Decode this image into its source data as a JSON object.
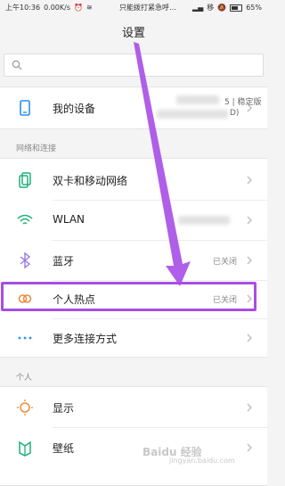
{
  "status": {
    "time": "上午10:36",
    "speed": "0.00K/s",
    "center_text": "只能拨打紧急呼…",
    "carrier": "移",
    "battery": "65%"
  },
  "page": {
    "title": "设置"
  },
  "search": {
    "placeholder": ""
  },
  "device": {
    "label": "我的设备",
    "version_top": "5 | 稳定版",
    "version_bottom": "D)"
  },
  "network_section": {
    "header": "网络和连接",
    "items": [
      {
        "label": "双卡和移动网络",
        "value": ""
      },
      {
        "label": "WLAN",
        "value": ""
      },
      {
        "label": "蓝牙",
        "value": "已关闭"
      },
      {
        "label": "个人热点",
        "value": "已关闭"
      },
      {
        "label": "更多连接方式",
        "value": ""
      }
    ]
  },
  "personal_section": {
    "header": "个人",
    "items": [
      {
        "label": "显示",
        "value": ""
      },
      {
        "label": "壁纸",
        "value": ""
      }
    ]
  },
  "watermark": {
    "main": "Baidu 经验",
    "sub": "jingyan.baidu.com"
  },
  "colors": {
    "accent_blue": "#2b8ef0",
    "accent_green": "#1fb07a",
    "accent_purple": "#9c7be0",
    "accent_orange": "#f08a3a",
    "annotation_purple": "#a64ee6"
  }
}
